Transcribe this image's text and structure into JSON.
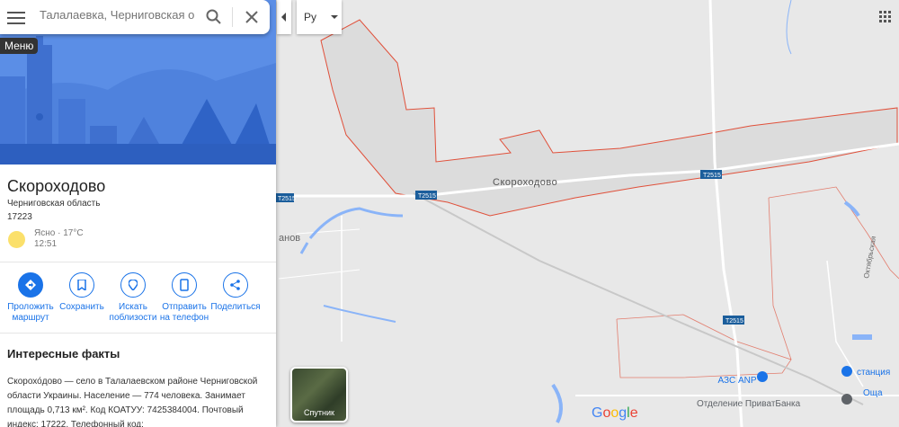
{
  "search": {
    "placeholder": "Талалаевка, Черниговская обла"
  },
  "tooltip": "Меню",
  "place": {
    "title": "Скороходово",
    "region": "Черниговская область",
    "postcode": "17223",
    "weather": {
      "text": "Ясно · 17°C",
      "time": "12:51"
    }
  },
  "actions": [
    {
      "label1": "Проложить",
      "label2": "маршрут"
    },
    {
      "label1": "Сохранить",
      "label2": ""
    },
    {
      "label1": "Искать",
      "label2": "поблизости"
    },
    {
      "label1": "Отправить",
      "label2": "на телефон"
    },
    {
      "label1": "Поделиться",
      "label2": ""
    }
  ],
  "facts": {
    "title": "Интересные факты",
    "text": "Скорохо́дово — село в Талалаевском районе Черниговской области Украины. Население — 774 человека. Занимает площадь 0,713 км². Код КОАТУУ: 7425384004. Почтовый индекс: 17222. Телефонный код:"
  },
  "map": {
    "language": "Ру",
    "labels": {
      "village": "Скороходово",
      "partial": "анов",
      "street": "Октябрьская",
      "road1": "Т2515",
      "road2": "Т2515",
      "road3": "Т2515",
      "road4": "Т2515",
      "gas": "АЗС ANP",
      "bank": "Отделение ПриватБанка",
      "station": "станция",
      "osh": "Оща"
    },
    "satellite_label": "Спутник",
    "logo": "Google"
  },
  "colors": {
    "accent": "#1a73e8",
    "boundary": "#e0503a",
    "road_badge": "#1b5e9c",
    "water": "#8ab4f8"
  }
}
